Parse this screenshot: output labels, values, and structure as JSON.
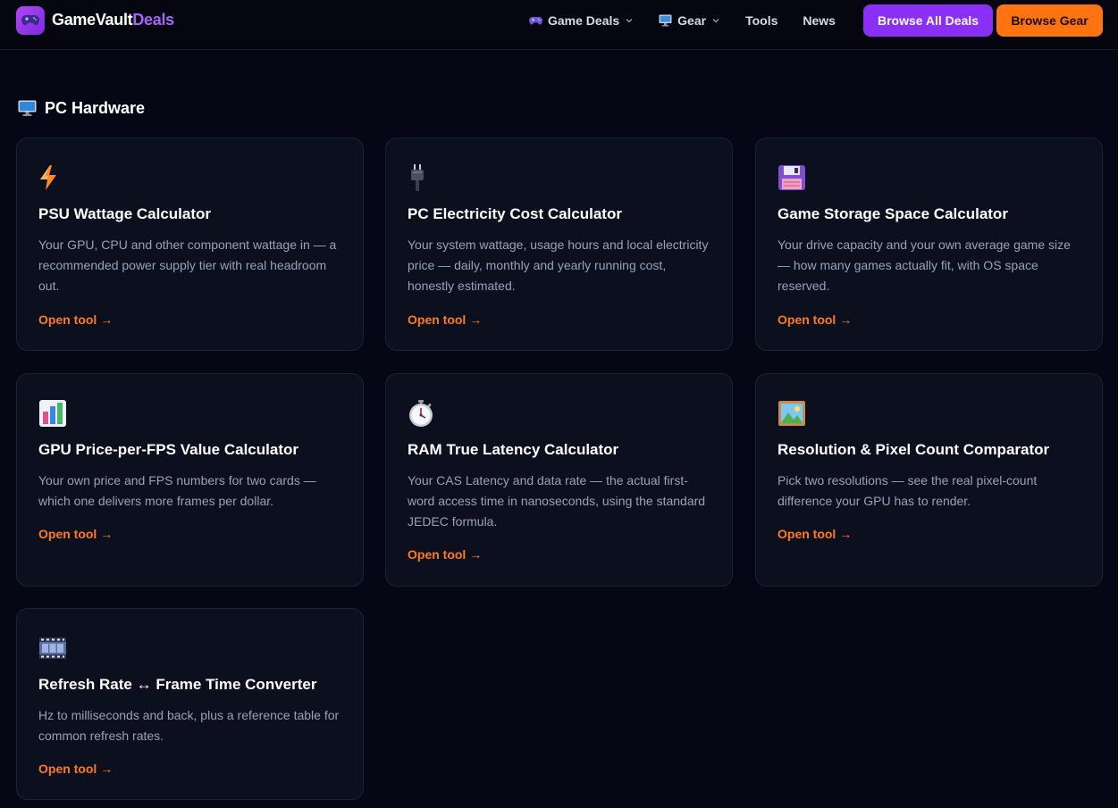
{
  "brand": {
    "name_part1": "GameVault",
    "name_part2": "Deals",
    "icon": "gamepad-icon",
    "primary_color": "#8a2ff5",
    "accent_color": "#ff7410"
  },
  "nav": {
    "items": [
      {
        "label": "Game Deals",
        "icon": "gamepad-icon",
        "has_dropdown": true
      },
      {
        "label": "Gear",
        "icon": "monitor-icon",
        "has_dropdown": true
      },
      {
        "label": "Tools",
        "has_dropdown": false
      },
      {
        "label": "News",
        "has_dropdown": false
      }
    ],
    "browse_deals_label": "Browse All Deals",
    "browse_gear_label": "Browse Gear"
  },
  "section": {
    "title": "PC Hardware",
    "icon": "desktop-computer-icon"
  },
  "tools": [
    {
      "title": "PSU Wattage Calculator",
      "description": "Your GPU, CPU and other component wattage in — a recommended power supply tier with real headroom out.",
      "link": "Open tool →",
      "icon": "lightning-icon"
    },
    {
      "title": "PC Electricity Cost Calculator",
      "description": "Your system wattage, usage hours and local electricity price — daily, monthly and yearly running cost, honestly estimated.",
      "link": "Open tool →",
      "icon": "power-plug-icon"
    },
    {
      "title": "Game Storage Space Calculator",
      "description": "Your drive capacity and your own average game size — how many games actually fit, with OS space reserved.",
      "link": "Open tool →",
      "icon": "floppy-disk-icon"
    },
    {
      "title": "GPU Price-per-FPS Value Calculator",
      "description": "Your own price and FPS numbers for two cards — which one delivers more frames per dollar.",
      "link": "Open tool →",
      "icon": "bar-chart-icon"
    },
    {
      "title": "RAM True Latency Calculator",
      "description": "Your CAS Latency and data rate — the actual first-word access time in nanoseconds, using the standard JEDEC formula.",
      "link": "Open tool →",
      "icon": "stopwatch-icon"
    },
    {
      "title": "Resolution & Pixel Count Comparator",
      "description": "Pick two resolutions — see the real pixel-count difference your GPU has to render.",
      "link": "Open tool →",
      "icon": "framed-picture-icon"
    },
    {
      "title": "Refresh Rate ↔ Frame Time Converter",
      "description": "Hz to milliseconds and back, plus a reference table for common refresh rates.",
      "link": "Open tool →",
      "icon": "film-frames-icon"
    }
  ]
}
